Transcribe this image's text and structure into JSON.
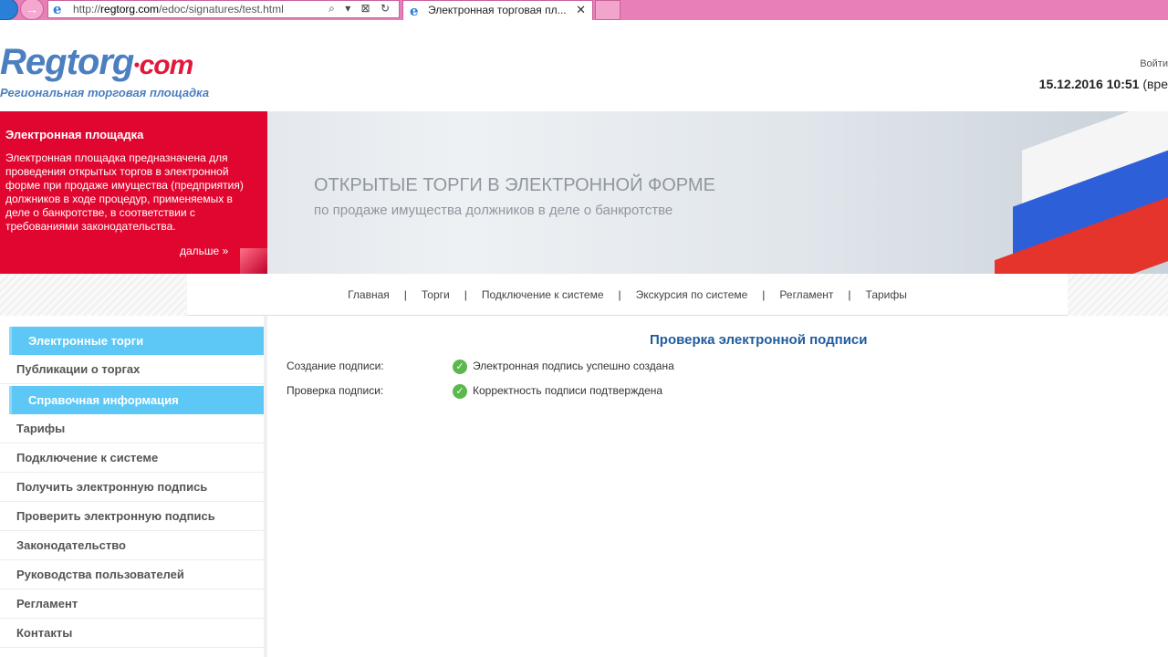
{
  "browser": {
    "url_prefix": "http://",
    "url_host": "regtorg.com",
    "url_path": "/edoc/signatures/test.html",
    "tab_title": "Электронная торговая пл...",
    "tab_close": "✕",
    "forward_glyph": "→",
    "address_tools": "⌕ ▾ ⊠ ↻",
    "ie_glyph": "e"
  },
  "header": {
    "logo_main": "Regtorg",
    "logo_dot": "●",
    "logo_com": "com",
    "logo_tagline": "Региональная торговая площадка",
    "login_link": "Войти",
    "datetime": "15.12.2016 10:51",
    "datetime_suffix": "(вре"
  },
  "banner": {
    "promo_title": "Электронная площадка",
    "promo_text": "Электронная площадка предназначена для проведения открытых торгов в электронной форме при продаже имущества (предприятия) должников в ходе процедур, применяемых в деле о банкротстве, в соответствии с требованиями законодательства.",
    "promo_more": "дальше »",
    "headline": "ОТКРЫТЫЕ ТОРГИ В ЭЛЕКТРОННОЙ ФОРМЕ",
    "subheadline": "по продаже имущества должников в деле о банкротстве"
  },
  "nav": {
    "items": [
      "Главная",
      "Торги",
      "Подключение к системе",
      "Экскурсия по системе",
      "Регламент",
      "Тарифы"
    ],
    "separator": "|"
  },
  "sidebar": {
    "head1": "Электронные торги",
    "item_publications": "Публикации о торгах",
    "head2": "Справочная информация",
    "items": [
      "Тарифы",
      "Подключение к системе",
      "Получить электронную подпись",
      "Проверить электронную подпись",
      "Законодательство",
      "Руководства пользователей",
      "Регламент",
      "Контакты"
    ]
  },
  "main": {
    "title": "Проверка электронной подписи",
    "rows": [
      {
        "label": "Создание подписи:",
        "value": "Электронная подпись успешно создана"
      },
      {
        "label": "Проверка подписи:",
        "value": "Корректность подписи подтверждена"
      }
    ],
    "check_glyph": "✓"
  },
  "colors": {
    "chrome": "#e87fb8",
    "promo_red": "#e1062f",
    "sidebar_head": "#5dc8f5",
    "title_blue": "#1f5c9e",
    "check_green": "#5bb84c"
  }
}
